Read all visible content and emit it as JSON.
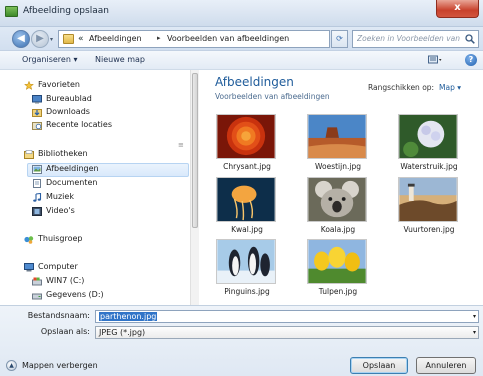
{
  "window": {
    "title": "Afbeelding opslaan",
    "close_symbol": "x"
  },
  "address": {
    "back_symbol": "◀",
    "forward_symbol": "▶",
    "crumb_prefix": "«",
    "crumbs": [
      "Afbeeldingen",
      "Voorbeelden van afbeeldingen"
    ],
    "separator": "▸",
    "dropdown_symbol": "▾",
    "refresh_symbol": "⟳",
    "search_placeholder": "Zoeken in Voorbeelden van af..."
  },
  "toolbar": {
    "organize_label": "Organiseren ▾",
    "new_folder_label": "Nieuwe map",
    "help_symbol": "?"
  },
  "nav": {
    "favorites": {
      "label": "Favorieten",
      "items": [
        "Bureaublad",
        "Downloads",
        "Recente locaties"
      ]
    },
    "libraries": {
      "label": "Bibliotheken",
      "items": [
        "Afbeeldingen",
        "Documenten",
        "Muziek",
        "Video's"
      ]
    },
    "homegroup": {
      "label": "Thuisgroep"
    },
    "computer": {
      "label": "Computer",
      "items": [
        "WIN7 (C:)",
        "Gegevens (D:)"
      ]
    },
    "grip_symbol": "≡"
  },
  "content": {
    "title": "Afbeeldingen",
    "subtitle": "Voorbeelden van afbeeldingen",
    "arrange_label": "Rangschikken op:",
    "arrange_value": "Map ▾",
    "files": [
      "Chrysant.jpg",
      "Woestijn.jpg",
      "Waterstruik.jpg",
      "Kwal.jpg",
      "Koala.jpg",
      "Vuurtoren.jpg",
      "Pinguins.jpg",
      "Tulpen.jpg"
    ]
  },
  "form": {
    "filename_label": "Bestandsnaam:",
    "filename_value": "parthenon.jpg",
    "filetype_label": "Opslaan als:",
    "filetype_value": "JPEG (*.jpg)",
    "dropdown_symbol": "▾",
    "hide_folders_label": "Mappen verbergen",
    "hide_symbol": "▲",
    "save_label": "Opslaan",
    "cancel_label": "Annuleren"
  }
}
